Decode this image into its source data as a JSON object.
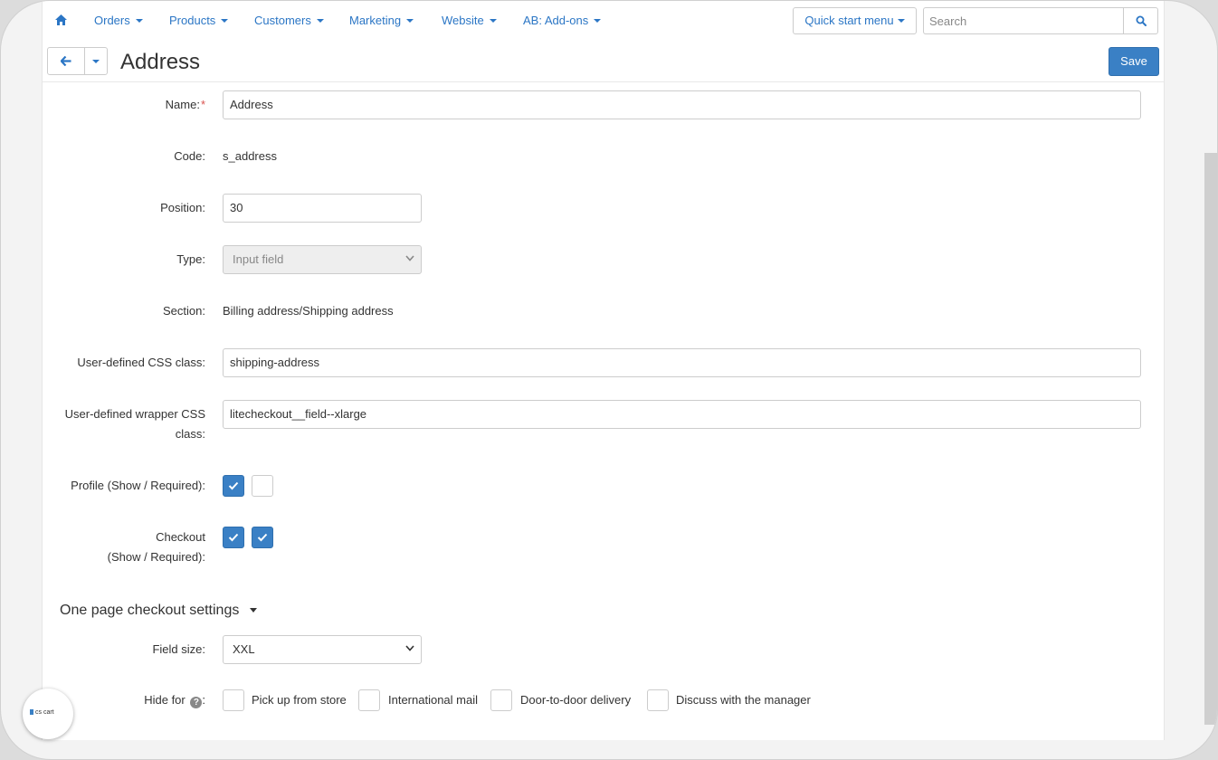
{
  "nav": {
    "items": [
      "Orders",
      "Products",
      "Customers",
      "Marketing",
      "Website",
      "AB: Add-ons"
    ],
    "quick_start": "Quick start menu",
    "search_placeholder": "Search"
  },
  "header": {
    "title": "Address",
    "save_label": "Save"
  },
  "form": {
    "name_label": "Name:",
    "name_required_mark": "*",
    "name_value": "Address",
    "code_label": "Code:",
    "code_value": "s_address",
    "position_label": "Position:",
    "position_value": "30",
    "type_label": "Type:",
    "type_value": "Input field",
    "section_label": "Section:",
    "section_value": "Billing address/Shipping address",
    "css_class_label": "User-defined CSS class:",
    "css_class_value": "shipping-address",
    "wrapper_label_line1": "User-defined wrapper CSS",
    "wrapper_label_line2": "class:",
    "wrapper_value": "litecheckout__field--xlarge",
    "profile_label": "Profile (Show / Required):",
    "profile_show": true,
    "profile_required": false,
    "checkout_label_line1": "Checkout",
    "checkout_label_line2": "(Show / Required):",
    "checkout_show": true,
    "checkout_required": true
  },
  "one_page": {
    "title": "One page checkout settings",
    "field_size_label": "Field size:",
    "field_size_value": "XXL",
    "hide_for_label": "Hide for",
    "hide_options": [
      "Pick up from store",
      "International mail",
      "Door-to-door delivery",
      "Discuss with the manager"
    ]
  },
  "logo": {
    "text": "cs cart"
  },
  "colors": {
    "accent": "#3a80c5",
    "link": "#2b76c5",
    "required": "#d9534f"
  }
}
